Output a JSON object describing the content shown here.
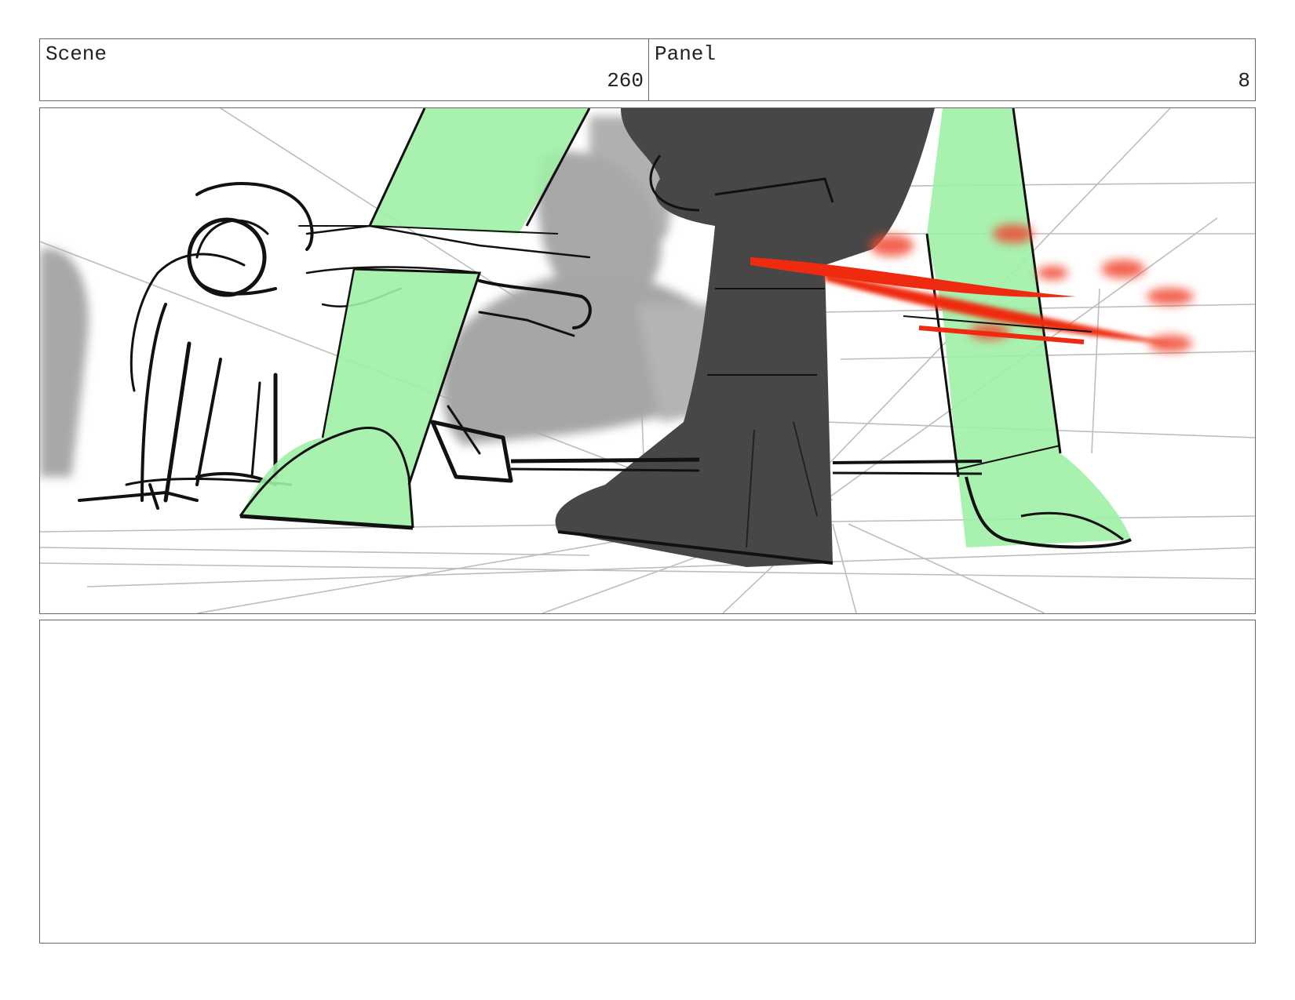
{
  "header": {
    "scene_label": "Scene",
    "scene_number": "260",
    "panel_label": "Panel",
    "panel_number": "8"
  },
  "artwork": {
    "description_icon": "storyboard-sketch",
    "colors": {
      "green_leg": "#9ef0a6",
      "dark_leg": "#474747",
      "laser_red": "#ee2a10",
      "blur_gray": "#a8a8a8"
    }
  },
  "notes": {
    "text": ""
  }
}
